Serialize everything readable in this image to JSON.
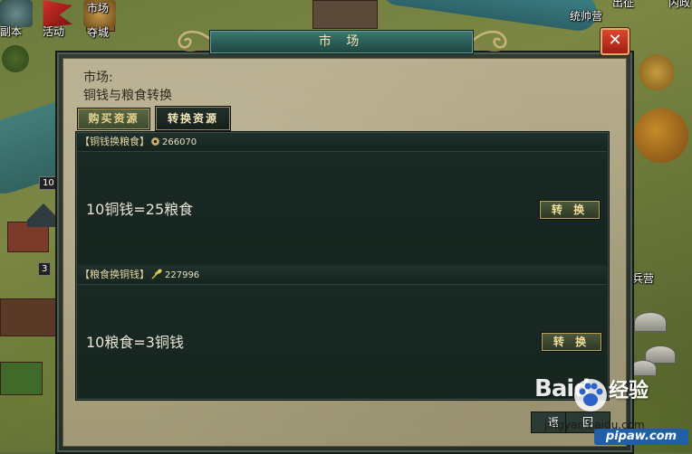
{
  "map": {
    "labels": {
      "fuben": "副本",
      "huodong": "活动",
      "duocheng": "夺城",
      "shichang": "市场",
      "tongshuaiying": "统帅营",
      "bingying": "兵营",
      "chuzheng": "出征",
      "neizheng": "内政"
    },
    "badges": {
      "level_10": "10",
      "level_3": "3"
    }
  },
  "dialog": {
    "title": "市 场",
    "close_label": "✕",
    "heading_line1": "市场:",
    "heading_line2": "铜钱与粮食转换",
    "tabs": [
      {
        "label": "购买资源",
        "active": false
      },
      {
        "label": "转换资源",
        "active": true
      }
    ],
    "sections": [
      {
        "title": "【铜钱换粮食】",
        "icon": "coin-icon",
        "amount": "266070",
        "formula": "10铜钱=25粮食",
        "button": "转 换"
      },
      {
        "title": "【粮食换铜钱】",
        "icon": "grain-icon",
        "amount": "227996",
        "formula": "10粮食=3铜钱",
        "button": "转 换"
      }
    ],
    "bottom_buttons": {
      "left": "返",
      "right": "回"
    }
  },
  "watermark": {
    "baidu": "Baid",
    "jingyan": "经验",
    "url": "jingyan.baidu.com",
    "pipaw": "pipaw.com"
  },
  "colors": {
    "title_bar": "#2a5a54",
    "parchment": "#aca380",
    "panel": "#1b2a26",
    "accent_gold": "#f1dd9c",
    "close_red": "#c6321f"
  }
}
